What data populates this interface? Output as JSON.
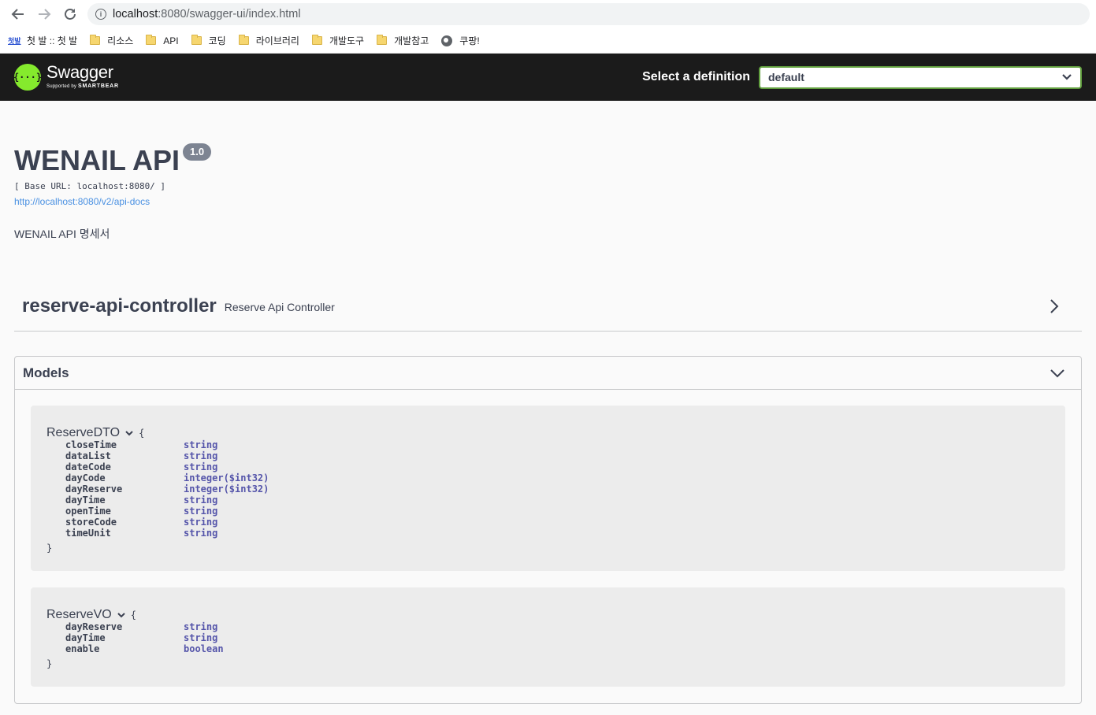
{
  "browser": {
    "url_host": "localhost",
    "url_path": ":8080/swagger-ui/index.html"
  },
  "bookmarks": [
    {
      "label": "첫 발 :: 첫 발",
      "icon": "site-favicon-icon"
    },
    {
      "label": "리소스",
      "icon": "folder-icon"
    },
    {
      "label": "API",
      "icon": "folder-icon"
    },
    {
      "label": "코딩",
      "icon": "folder-icon"
    },
    {
      "label": "라이브러리",
      "icon": "folder-icon"
    },
    {
      "label": "개발도구",
      "icon": "folder-icon"
    },
    {
      "label": "개발참고",
      "icon": "folder-icon"
    },
    {
      "label": "쿠팡!",
      "icon": "globe-icon"
    }
  ],
  "topbar": {
    "logo_name": "Swagger",
    "logo_sub_prefix": "Supported by",
    "logo_sub_brand": "SMARTBEAR",
    "definition_label": "Select a definition",
    "definition_selected": "default",
    "accent": "#85ea2d"
  },
  "info": {
    "title": "WENAIL API",
    "version": "1.0",
    "base_url": "[ Base URL: localhost:8080/ ]",
    "docs_link": "http://localhost:8080/v2/api-docs",
    "description": "WENAIL API 명세서"
  },
  "tag": {
    "name": "reserve-api-controller",
    "description": "Reserve Api Controller"
  },
  "models": {
    "title": "Models",
    "items": [
      {
        "name": "ReserveDTO",
        "open_brace": "{",
        "close_brace": "}",
        "properties": [
          {
            "name": "closeTime",
            "type": "string"
          },
          {
            "name": "dataList",
            "type": "string"
          },
          {
            "name": "dateCode",
            "type": "string"
          },
          {
            "name": "dayCode",
            "type": "integer($int32)"
          },
          {
            "name": "dayReserve",
            "type": "integer($int32)"
          },
          {
            "name": "dayTime",
            "type": "string"
          },
          {
            "name": "openTime",
            "type": "string"
          },
          {
            "name": "storeCode",
            "type": "string"
          },
          {
            "name": "timeUnit",
            "type": "string"
          }
        ]
      },
      {
        "name": "ReserveVO",
        "open_brace": "{",
        "close_brace": "}",
        "properties": [
          {
            "name": "dayReserve",
            "type": "string"
          },
          {
            "name": "dayTime",
            "type": "string"
          },
          {
            "name": "enable",
            "type": "boolean"
          }
        ]
      }
    ]
  }
}
